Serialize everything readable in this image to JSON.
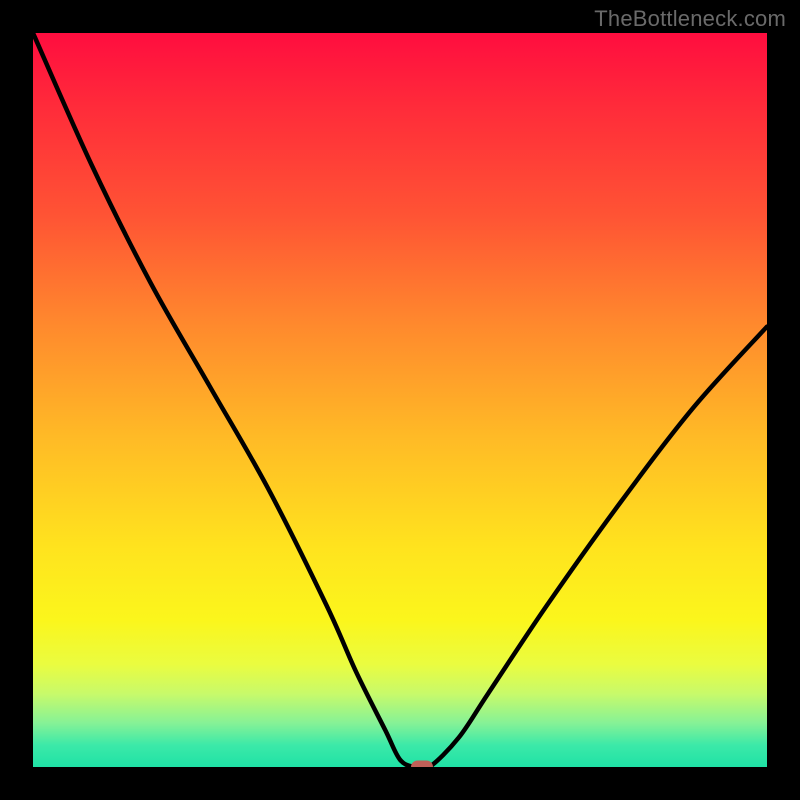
{
  "watermark": "TheBottleneck.com",
  "colors": {
    "frame_bg": "#000000",
    "curve_stroke": "#000000",
    "marker_fill": "#c06058",
    "gradient_top": "#ff0d3f",
    "gradient_bottom": "#1fe2a6"
  },
  "chart_data": {
    "type": "line",
    "title": "",
    "xlabel": "",
    "ylabel": "",
    "xlim": [
      0,
      100
    ],
    "ylim": [
      0,
      100
    ],
    "grid": false,
    "legend_position": "none",
    "series": [
      {
        "name": "bottleneck-curve",
        "x": [
          0,
          8,
          16,
          24,
          32,
          40,
          44,
          48,
          50,
          52,
          54,
          58,
          62,
          70,
          80,
          90,
          100
        ],
        "y": [
          100,
          82,
          66,
          52,
          38,
          22,
          13,
          5,
          1,
          0,
          0,
          4,
          10,
          22,
          36,
          49,
          60
        ]
      }
    ],
    "marker": {
      "x": 53,
      "y": 0
    },
    "notes": "V-shaped curve on a vertical heat gradient; y values are visual estimates (0 = bottom / green, 100 = top / red). No tick labels, axes, or numeric data labels are present in the image."
  }
}
